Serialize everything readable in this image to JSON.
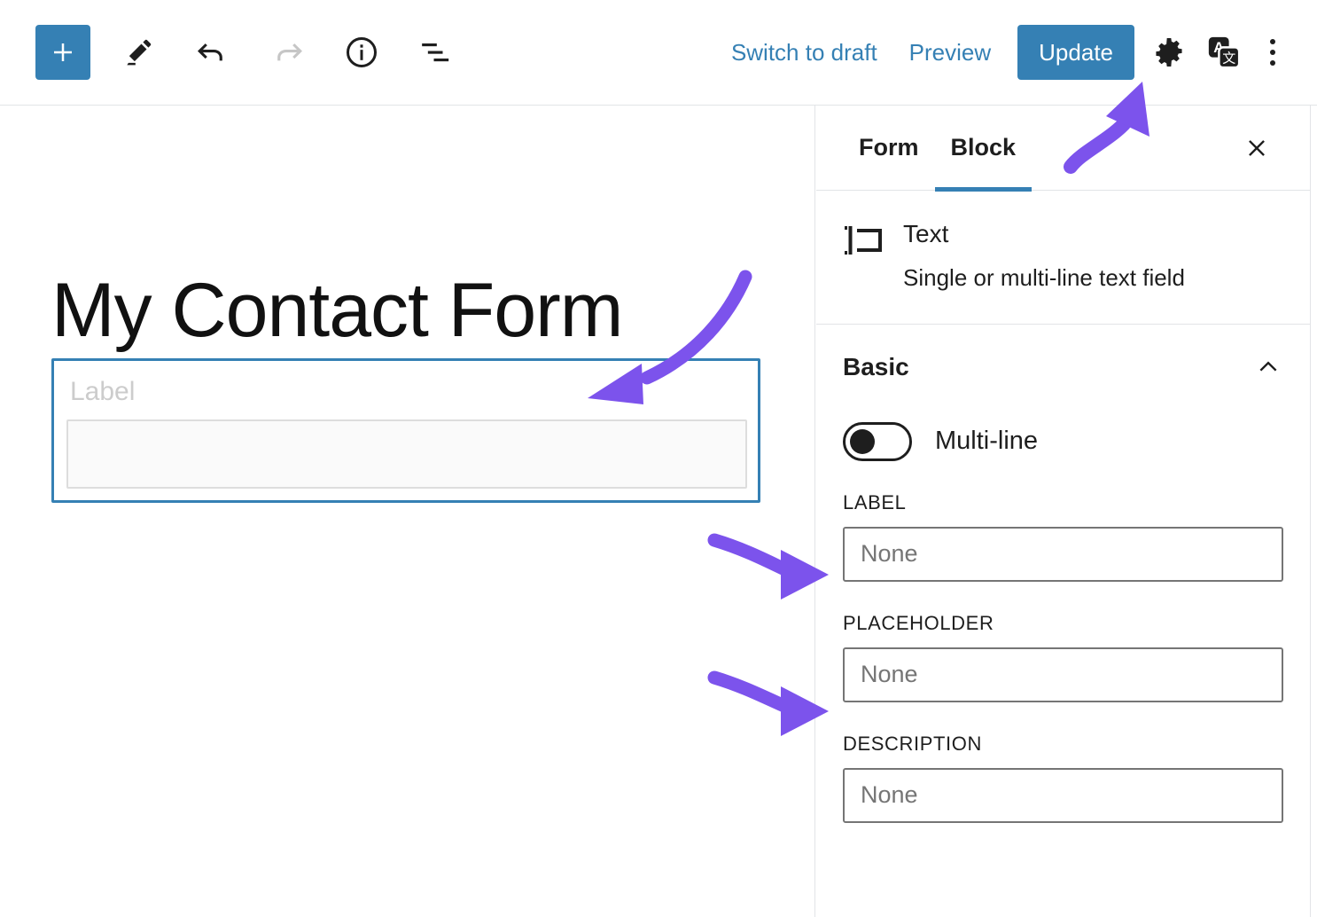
{
  "colors": {
    "accent_blue": "#3580b4",
    "annotation_purple": "#7c53ec",
    "text_dark": "#1e1e1e",
    "border_gray": "#e2e4e7",
    "placeholder_gray": "#757575"
  },
  "toolbar": {
    "add_block_label": "+",
    "add_block_icon": "plus-icon",
    "tools_icon": "pencil-icon",
    "undo_icon": "undo-arrow-icon",
    "redo_icon": "redo-arrow-icon",
    "info_icon": "info-circle-icon",
    "list_view_icon": "list-view-icon",
    "switch_to_draft_label": "Switch to draft",
    "preview_label": "Preview",
    "update_label": "Update",
    "settings_icon": "gear-icon",
    "translate_icon": "translate-icon",
    "more_options_icon": "kebab-menu-icon"
  },
  "canvas": {
    "post_title": "My Contact Form",
    "block": {
      "label_placeholder": "Label",
      "input_value": ""
    }
  },
  "sidebar": {
    "tabs": [
      {
        "label": "Form",
        "active": false
      },
      {
        "label": "Block",
        "active": true
      }
    ],
    "close_icon": "close-icon",
    "block_card": {
      "icon": "text-field-icon",
      "title": "Text",
      "description": "Single or multi-line text field"
    },
    "sections": [
      {
        "title": "Basic",
        "collapse_icon": "chevron-up-icon",
        "expanded": true,
        "toggle": {
          "label": "Multi-line",
          "state": "off"
        },
        "fields": [
          {
            "caption": "LABEL",
            "value": "",
            "placeholder": "None"
          },
          {
            "caption": "PLACEHOLDER",
            "value": "",
            "placeholder": "None"
          },
          {
            "caption": "DESCRIPTION",
            "value": "",
            "placeholder": "None"
          }
        ]
      }
    ]
  },
  "annotations": [
    {
      "name": "arrow-to-settings-gear",
      "color": "#7c53ec"
    },
    {
      "name": "arrow-to-form-block",
      "color": "#7c53ec"
    },
    {
      "name": "arrow-to-label-field",
      "color": "#7c53ec"
    },
    {
      "name": "arrow-to-placeholder-field",
      "color": "#7c53ec"
    }
  ]
}
